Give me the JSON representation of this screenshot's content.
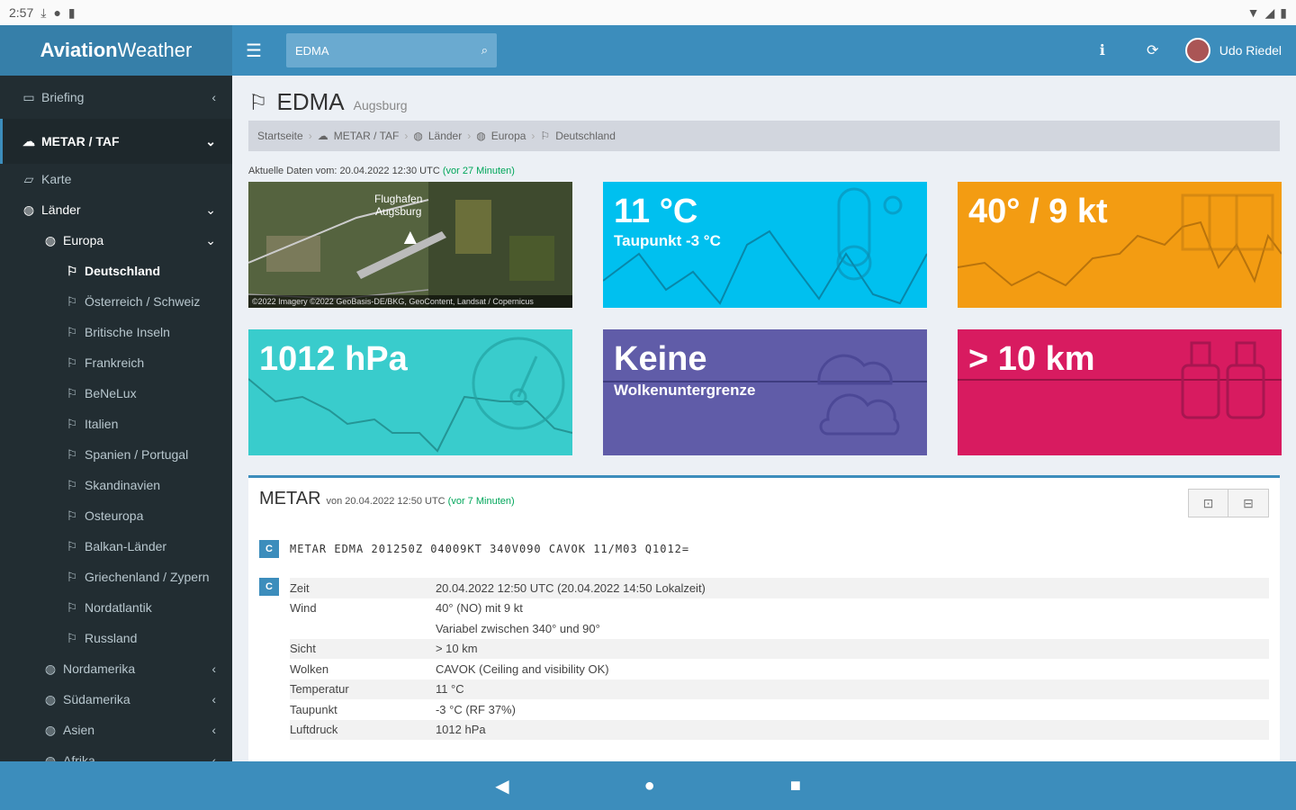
{
  "status": {
    "time": "2:57"
  },
  "app": {
    "logo_bold": "Aviation",
    "logo_rest": "Weather"
  },
  "search": {
    "value": "EDMA"
  },
  "user": {
    "name": "Udo Riedel"
  },
  "sidebar": {
    "items": [
      {
        "label": "Briefing",
        "icon": "briefcase-icon",
        "chev": "‹"
      },
      {
        "label": "METAR / TAF",
        "icon": "cloud-icon",
        "chev": "⌄"
      },
      {
        "label": "Karte",
        "icon": "map-icon",
        "chev": ""
      },
      {
        "label": "Länder",
        "icon": "globe-icon",
        "chev": "⌄"
      },
      {
        "label": "Europa",
        "icon": "globe-icon",
        "chev": "⌄"
      },
      {
        "label": "Deutschland",
        "icon": "flag-icon"
      },
      {
        "label": "Österreich / Schweiz",
        "icon": "flag-icon"
      },
      {
        "label": "Britische Inseln",
        "icon": "flag-icon"
      },
      {
        "label": "Frankreich",
        "icon": "flag-icon"
      },
      {
        "label": "BeNeLux",
        "icon": "flag-icon"
      },
      {
        "label": "Italien",
        "icon": "flag-icon"
      },
      {
        "label": "Spanien / Portugal",
        "icon": "flag-icon"
      },
      {
        "label": "Skandinavien",
        "icon": "flag-icon"
      },
      {
        "label": "Osteuropa",
        "icon": "flag-icon"
      },
      {
        "label": "Balkan-Länder",
        "icon": "flag-icon"
      },
      {
        "label": "Griechenland / Zypern",
        "icon": "flag-icon"
      },
      {
        "label": "Nordatlantik",
        "icon": "flag-icon"
      },
      {
        "label": "Russland",
        "icon": "flag-icon"
      },
      {
        "label": "Nordamerika",
        "icon": "globe-icon",
        "chev": "‹"
      },
      {
        "label": "Südamerika",
        "icon": "globe-icon",
        "chev": "‹"
      },
      {
        "label": "Asien",
        "icon": "globe-icon",
        "chev": "‹"
      },
      {
        "label": "Afrika",
        "icon": "globe-icon",
        "chev": "‹"
      }
    ]
  },
  "page": {
    "title": "EDMA",
    "subtitle": "Augsburg"
  },
  "breadcrumb": [
    "Startseite",
    "METAR / TAF",
    "Länder",
    "Europa",
    "Deutschland"
  ],
  "updated": {
    "prefix": "Aktuelle Daten vom: 20.04.2022 12:30 UTC",
    "ago": "(vor 27 Minuten)"
  },
  "map": {
    "label_line1": "Flughafen",
    "label_line2": "Augsburg",
    "attribution": "©2022 Imagery ©2022 GeoBasis-DE/BKG, GeoContent, Landsat / Copernicus"
  },
  "tiles": {
    "temp": {
      "value": "11 °C",
      "caption": "Taupunkt -3 °C",
      "color": "#00c0ef"
    },
    "wind": {
      "value": "40° / 9 kt",
      "color": "#f39c12"
    },
    "pressure": {
      "value": "1012 hPa",
      "color": "#39cccc"
    },
    "cloud": {
      "value": "Keine",
      "caption": "Wolkenuntergrenze",
      "color": "#605ca8"
    },
    "visibility": {
      "value": "> 10 km",
      "color": "#d81b60"
    }
  },
  "metar": {
    "title": "METAR",
    "subtitle": "von 20.04.2022 12:50 UTC",
    "ago": "(vor 7 Minuten)",
    "raw_badge": "C",
    "raw": "METAR EDMA 201250Z 04009KT 340V090 CAVOK 11/M03 Q1012=",
    "decoded_badge": "C",
    "rows": [
      {
        "k": "Zeit",
        "v": "20.04.2022 12:50 UTC (20.04.2022 14:50 Lokalzeit)"
      },
      {
        "k": "Wind",
        "v": "40° (NO) mit 9 kt"
      },
      {
        "k": "",
        "v": "Variabel zwischen 340° und 90°"
      },
      {
        "k": "Sicht",
        "v": "> 10 km"
      },
      {
        "k": "Wolken",
        "v": "CAVOK (Ceiling and visibility OK)"
      },
      {
        "k": "Temperatur",
        "v": "11 °C"
      },
      {
        "k": "Taupunkt",
        "v": "-3 °C (RF 37%)"
      },
      {
        "k": "Luftdruck",
        "v": "1012 hPa"
      }
    ]
  }
}
